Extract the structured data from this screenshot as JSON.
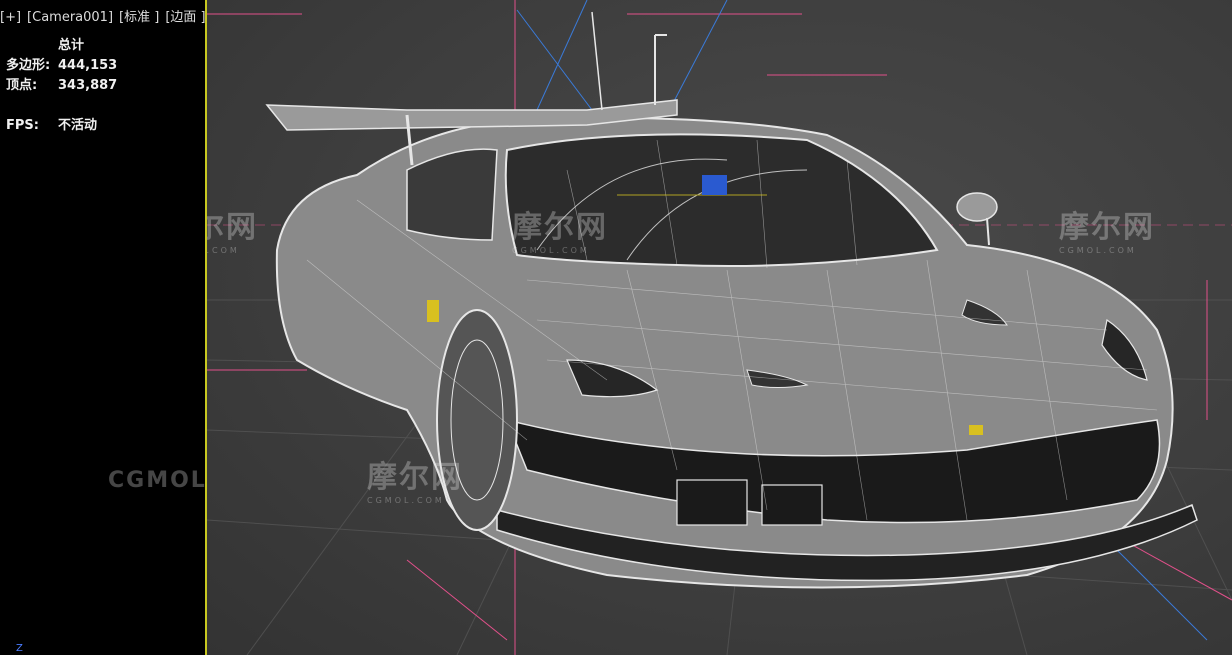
{
  "viewport": {
    "menu_plus": "[+]",
    "camera": "[Camera001]",
    "shading_standard": "[标准 ]",
    "shading_edged": "[边面 ]"
  },
  "stats": {
    "heading": "总计",
    "polygons_label": "多边形:",
    "polygons_value": "444,153",
    "vertices_label": "顶点:",
    "vertices_value": "343,887",
    "fps_label": "FPS:",
    "fps_value": "不活动"
  },
  "watermarks": {
    "brand_cn": "摩尔网",
    "brand_en": "CGMOL.COM",
    "brand_short": "CGMOL"
  },
  "axis_label": "Z",
  "colors": {
    "viewport_bg": "#3e3e3e",
    "active_border": "#c8c820",
    "wire": "#e6e6e6",
    "gizmo_pink": "#e0508a",
    "gizmo_blue": "#3a7ad8"
  }
}
